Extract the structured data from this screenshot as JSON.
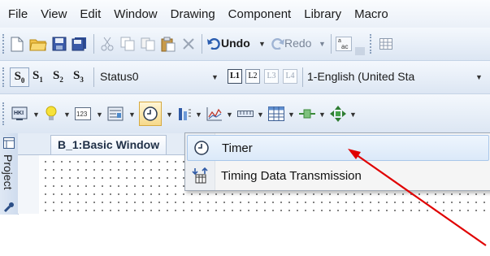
{
  "menubar": {
    "items": [
      "File",
      "View",
      "Edit",
      "Window",
      "Drawing",
      "Component",
      "Library",
      "Macro"
    ]
  },
  "toolbar1": {
    "undo_label": "Undo",
    "redo_label": "Redo"
  },
  "toolbar2": {
    "state_buttons": [
      "S",
      "S",
      "S",
      "S"
    ],
    "state_subs": [
      "0",
      "1",
      "2",
      "3"
    ],
    "status_value": "Status0",
    "layer_buttons": [
      "L1",
      "L2",
      "L3",
      "L4"
    ],
    "language_value": "1-English (United Sta"
  },
  "side_panel": {
    "project_label": "Project"
  },
  "document_tab": {
    "title": "B_1:Basic Window"
  },
  "timer_menu": {
    "items": [
      {
        "label": "Timer",
        "icon": "clock-icon"
      },
      {
        "label": "Timing Data Transmission",
        "icon": "timing-data-icon"
      }
    ]
  },
  "colors": {
    "accent_arrow": "#e00000",
    "toolbar_bg": "#e8eff8",
    "selection": "#dbe9f9"
  }
}
